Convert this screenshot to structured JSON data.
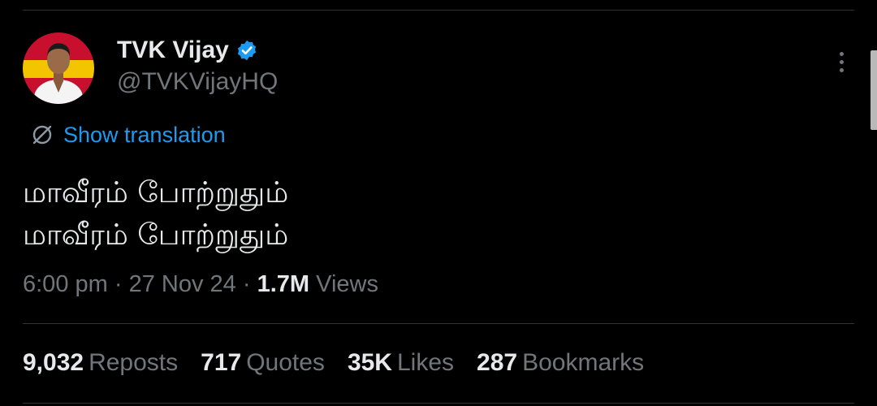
{
  "author": {
    "display_name": "TVK Vijay",
    "handle": "@TVKVijayHQ",
    "verified": true,
    "avatar_icon": "profile-photo"
  },
  "translation": {
    "label": "Show translation",
    "icon": "globe-icon"
  },
  "tweet": {
    "lines": [
      "மாவீரம் போற்றுதும்",
      "மாவீரம் போற்றுதும்"
    ]
  },
  "meta": {
    "time": "6:00 pm",
    "separator": "·",
    "date": "27 Nov 24",
    "views_count": "1.7M",
    "views_label": "Views"
  },
  "stats": [
    {
      "count": "9,032",
      "label": "Reposts"
    },
    {
      "count": "717",
      "label": "Quotes"
    },
    {
      "count": "35K",
      "label": "Likes"
    },
    {
      "count": "287",
      "label": "Bookmarks"
    }
  ],
  "colors": {
    "background": "#000000",
    "text_primary": "#e7e9ea",
    "text_secondary": "#71767b",
    "accent": "#1d9bf0",
    "divider": "#2f3336"
  }
}
